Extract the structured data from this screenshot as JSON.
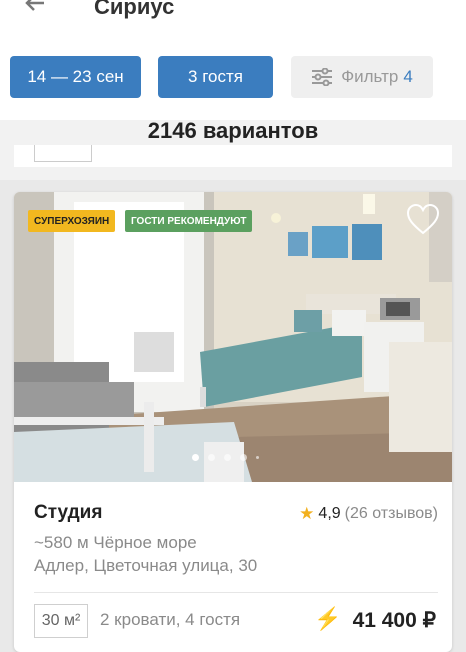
{
  "header": {
    "title": "Сириус",
    "dates_label": "14 — 23 сен",
    "guests_label": "3 гостя",
    "filter_label": "Фильтр",
    "filter_count": "4"
  },
  "results": {
    "count_text": "2146 вариантов"
  },
  "listing": {
    "badges": {
      "superhost": "СУПЕРХОЗЯИН",
      "recommended": "ГОСТИ РЕКОМЕНДУЮТ"
    },
    "name": "Студия",
    "rating": "4,9",
    "reviews": "(26 отзывов)",
    "distance": "~580 м Чёрное море",
    "address": "Адлер, Цветочная улица, 30",
    "area": "30 м²",
    "beds_guests": "2 кровати, 4 гостя",
    "price": "41 400 ₽",
    "photo_count_dots": 5,
    "active_dot": 1
  },
  "colors": {
    "accent": "#3b7dbf",
    "badge_super": "#f2b81f",
    "badge_rec": "#5ba05f",
    "star": "#f2b01e"
  },
  "icons": [
    "back-arrow-icon",
    "filter-sliders-icon",
    "heart-icon",
    "star-icon",
    "lightning-icon"
  ]
}
